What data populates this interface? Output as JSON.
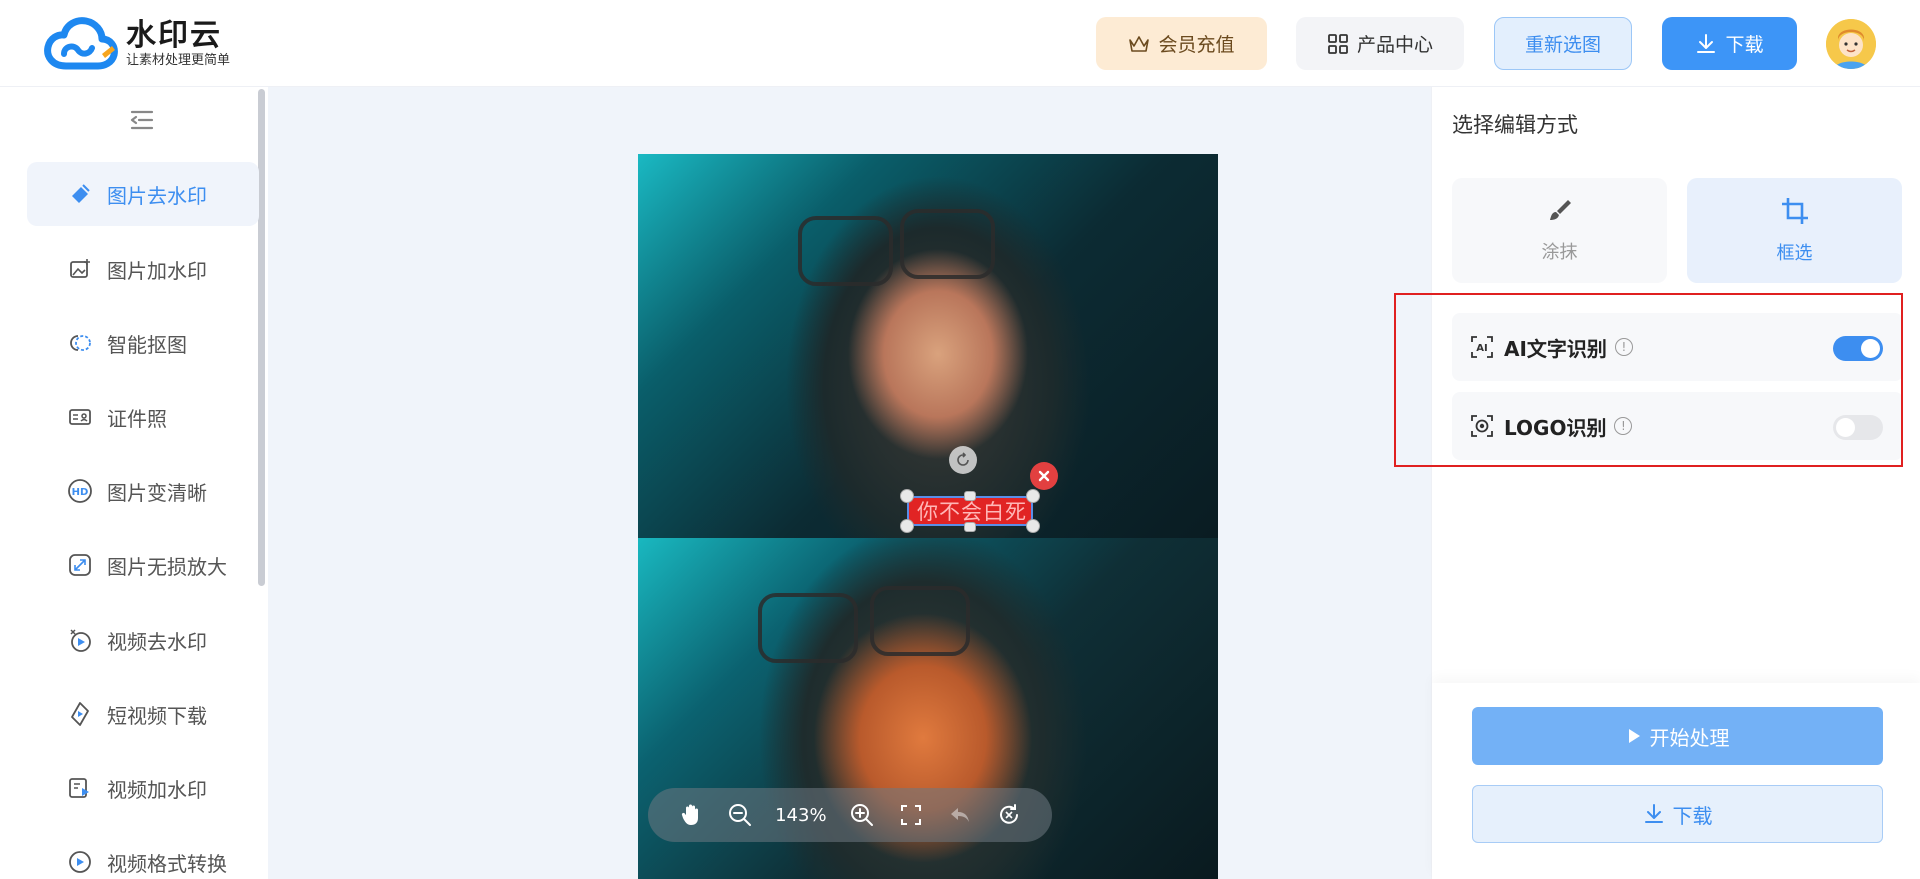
{
  "brand": {
    "title": "水印云",
    "tagline": "让素材处理更简单",
    "logo_icon": "cloud-logo-icon"
  },
  "header": {
    "vip_label": "会员充值",
    "products_label": "产品中心",
    "reselect_label": "重新选图",
    "download_label": "下载"
  },
  "sidebar": {
    "items": [
      {
        "label": "图片去水印",
        "icon": "eraser-icon",
        "active": true
      },
      {
        "label": "图片加水印",
        "icon": "image-add-icon",
        "active": false
      },
      {
        "label": "智能抠图",
        "icon": "cutout-icon",
        "active": false
      },
      {
        "label": "证件照",
        "icon": "id-card-icon",
        "active": false
      },
      {
        "label": "图片变清晰",
        "icon": "hd-icon",
        "active": false
      },
      {
        "label": "图片无损放大",
        "icon": "enlarge-icon",
        "active": false
      },
      {
        "label": "视频去水印",
        "icon": "video-eraser-icon",
        "active": false
      },
      {
        "label": "短视频下载",
        "icon": "video-download-icon",
        "active": false
      },
      {
        "label": "视频加水印",
        "icon": "video-add-icon",
        "active": false
      },
      {
        "label": "视频格式转换",
        "icon": "video-convert-icon",
        "active": false
      }
    ]
  },
  "canvas": {
    "selection_text": "你不会白死",
    "zoom_label": "143%"
  },
  "panel": {
    "title": "选择编辑方式",
    "modes": [
      {
        "label": "涂抹",
        "icon": "brush-icon",
        "selected": false
      },
      {
        "label": "框选",
        "icon": "crop-icon",
        "selected": true
      }
    ],
    "options": [
      {
        "label": "AI文字识别",
        "icon": "ai-text-icon",
        "enabled": true
      },
      {
        "label": "LOGO识别",
        "icon": "logo-scan-icon",
        "enabled": false
      }
    ],
    "start_label": "开始处理",
    "download_label": "下载"
  },
  "colors": {
    "accent": "#3d8ef0",
    "highlight": "#e02020",
    "vip_bg": "#fdebd4"
  }
}
